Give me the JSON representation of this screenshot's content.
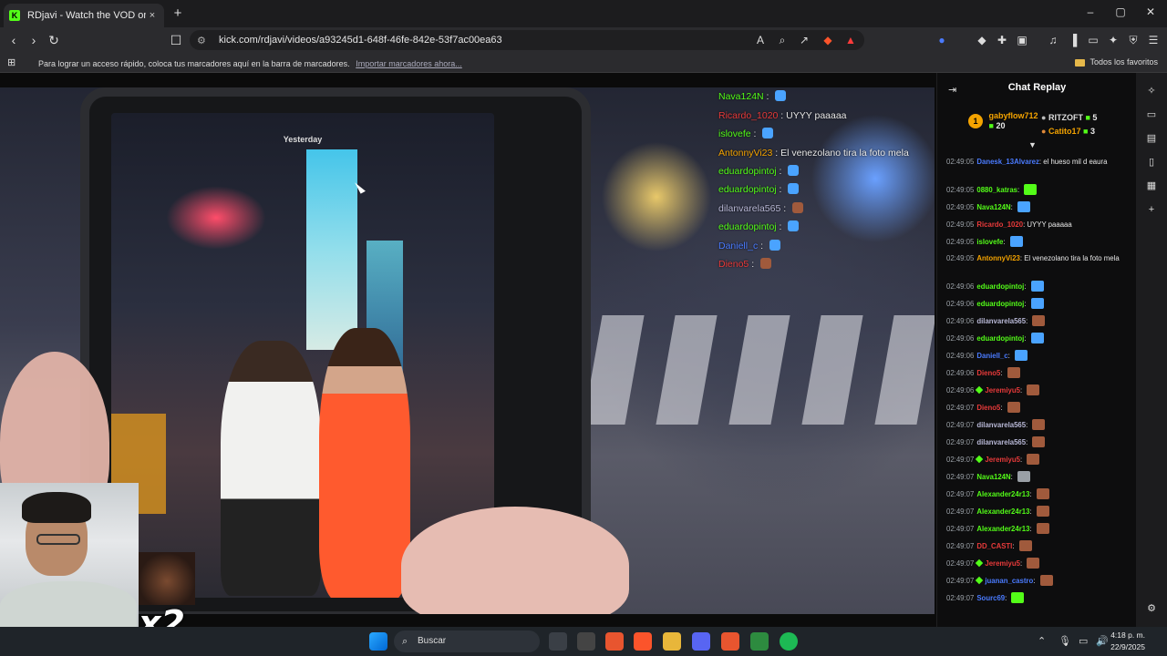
{
  "browser": {
    "tab_title": "RDjavi - Watch the VOD on K",
    "tab_close": "×",
    "new_tab": "+",
    "url": "kick.com/rdjavi/videos/a93245d1-648f-46fe-842e-53f7ac00ea63",
    "window_controls": {
      "minimize": "–",
      "maximize": "▢",
      "close": "✕"
    }
  },
  "bookmarks_bar": {
    "message": "Para lograr un acceso rápido, coloca tus marcadores aquí en la barra de marcadores.",
    "import_link": "Importar marcadores ahora...",
    "all_favorites": "Todos los favoritos"
  },
  "video": {
    "tablet_header": "Yesterday",
    "overlay_chat": [
      {
        "user": "Nava124N",
        "text": "",
        "color": "#53fc18",
        "emote": "#4aa3ff"
      },
      {
        "user": "Ricardo_1020",
        "text": "UYYY paaaaa",
        "color": "#e83a3a",
        "emote": ""
      },
      {
        "user": "islovefe",
        "text": "",
        "color": "#53fc18",
        "emote": "#4aa3ff"
      },
      {
        "user": "AntonnyVi23",
        "text": "El venezolano tira la foto mela",
        "color": "#f4a300",
        "emote": ""
      },
      {
        "user": "eduardopintoj",
        "text": "",
        "color": "#53fc18",
        "emote": "#4aa3ff"
      },
      {
        "user": "eduardopintoj",
        "text": "",
        "color": "#53fc18",
        "emote": "#4aa3ff"
      },
      {
        "user": "dilanvarela565",
        "text": "",
        "color": "#b8b8d6",
        "emote": "#a05a3c"
      },
      {
        "user": "eduardopintoj",
        "text": "",
        "color": "#53fc18",
        "emote": "#4aa3ff"
      },
      {
        "user": "Daniell_c",
        "text": "",
        "color": "#4a7bff",
        "emote": "#4aa3ff"
      },
      {
        "user": "Dieno5",
        "text": "",
        "color": "#e83a3a",
        "emote": "#a05a3c"
      }
    ],
    "webcam_multiplier": "x2"
  },
  "chat_panel": {
    "title": "Chat Replay",
    "leaderboard": [
      {
        "rank": "1",
        "user": "gabyflow712",
        "count": "20",
        "user_color": "#f4a300"
      },
      {
        "rank": "",
        "user": "RITZOFT",
        "count": "5",
        "user_color": "#dddddd"
      },
      {
        "rank": "",
        "user": "Catito17",
        "count": "3",
        "user_color": "#f4a300"
      }
    ],
    "messages": [
      {
        "time": "02:49:05",
        "user": "Danesk_13Alvarez",
        "text": "el hueso mil d eaura",
        "color": "#4a7bff",
        "emote": "",
        "badge": false
      },
      {
        "time": "02:49:05",
        "user": "0880_katras",
        "text": "",
        "color": "#53fc18",
        "emote": "#53fc18",
        "badge": false
      },
      {
        "time": "02:49:05",
        "user": "Nava124N",
        "text": "",
        "color": "#53fc18",
        "emote": "#4aa3ff",
        "badge": false
      },
      {
        "time": "02:49:05",
        "user": "Ricardo_1020",
        "text": "UYYY paaaaa",
        "color": "#e83a3a",
        "emote": "",
        "badge": false
      },
      {
        "time": "02:49:05",
        "user": "islovefe",
        "text": "",
        "color": "#53fc18",
        "emote": "#4aa3ff",
        "badge": false
      },
      {
        "time": "02:49:05",
        "user": "AntonnyVi23",
        "text": "El venezolano tira la foto mela",
        "color": "#f4a300",
        "emote": "",
        "badge": false
      },
      {
        "time": "02:49:06",
        "user": "eduardopintoj",
        "text": "",
        "color": "#53fc18",
        "emote": "#4aa3ff",
        "badge": false
      },
      {
        "time": "02:49:06",
        "user": "eduardopintoj",
        "text": "",
        "color": "#53fc18",
        "emote": "#4aa3ff",
        "badge": false
      },
      {
        "time": "02:49:06",
        "user": "dilanvarela565",
        "text": "",
        "color": "#b8b8d6",
        "emote": "#a05a3c",
        "badge": false
      },
      {
        "time": "02:49:06",
        "user": "eduardopintoj",
        "text": "",
        "color": "#53fc18",
        "emote": "#4aa3ff",
        "badge": false
      },
      {
        "time": "02:49:06",
        "user": "Daniell_c",
        "text": "",
        "color": "#4a7bff",
        "emote": "#4aa3ff",
        "badge": false
      },
      {
        "time": "02:49:06",
        "user": "Dieno5",
        "text": "",
        "color": "#e83a3a",
        "emote": "#a05a3c",
        "badge": false
      },
      {
        "time": "02:49:06",
        "user": "Jeremiyu5",
        "text": "",
        "color": "#e83a3a",
        "emote": "#a05a3c",
        "badge": true
      },
      {
        "time": "02:49:07",
        "user": "Dieno5",
        "text": "",
        "color": "#e83a3a",
        "emote": "#a05a3c",
        "badge": false
      },
      {
        "time": "02:49:07",
        "user": "dilanvarela565",
        "text": "",
        "color": "#b8b8d6",
        "emote": "#a05a3c",
        "badge": false
      },
      {
        "time": "02:49:07",
        "user": "dilanvarela565",
        "text": "",
        "color": "#b8b8d6",
        "emote": "#a05a3c",
        "badge": false
      },
      {
        "time": "02:49:07",
        "user": "Jeremiyu5",
        "text": "",
        "color": "#e83a3a",
        "emote": "#a05a3c",
        "badge": true
      },
      {
        "time": "02:49:07",
        "user": "Nava124N",
        "text": "",
        "color": "#53fc18",
        "emote": "#9aa0a6",
        "badge": false
      },
      {
        "time": "02:49:07",
        "user": "Alexander24r13",
        "text": "",
        "color": "#53fc18",
        "emote": "#a05a3c",
        "badge": false
      },
      {
        "time": "02:49:07",
        "user": "Alexander24r13",
        "text": "",
        "color": "#53fc18",
        "emote": "#a05a3c",
        "badge": false
      },
      {
        "time": "02:49:07",
        "user": "Alexander24r13",
        "text": "",
        "color": "#53fc18",
        "emote": "#a05a3c",
        "badge": false
      },
      {
        "time": "02:49:07",
        "user": "DD_CASTI",
        "text": "",
        "color": "#e83a3a",
        "emote": "#a05a3c",
        "badge": false
      },
      {
        "time": "02:49:07",
        "user": "Jeremiyu5",
        "text": "",
        "color": "#e83a3a",
        "emote": "#a05a3c",
        "badge": true
      },
      {
        "time": "02:49:07",
        "user": "juanan_castro",
        "text": "",
        "color": "#4a7bff",
        "emote": "#a05a3c",
        "badge": true
      },
      {
        "time": "02:49:07",
        "user": "Sourc69",
        "text": "",
        "color": "#4a7bff",
        "emote": "#53fc18",
        "badge": false
      }
    ]
  },
  "taskbar": {
    "search_placeholder": "Buscar",
    "time": "4:18 p. m.",
    "date": "22/9/2025"
  }
}
